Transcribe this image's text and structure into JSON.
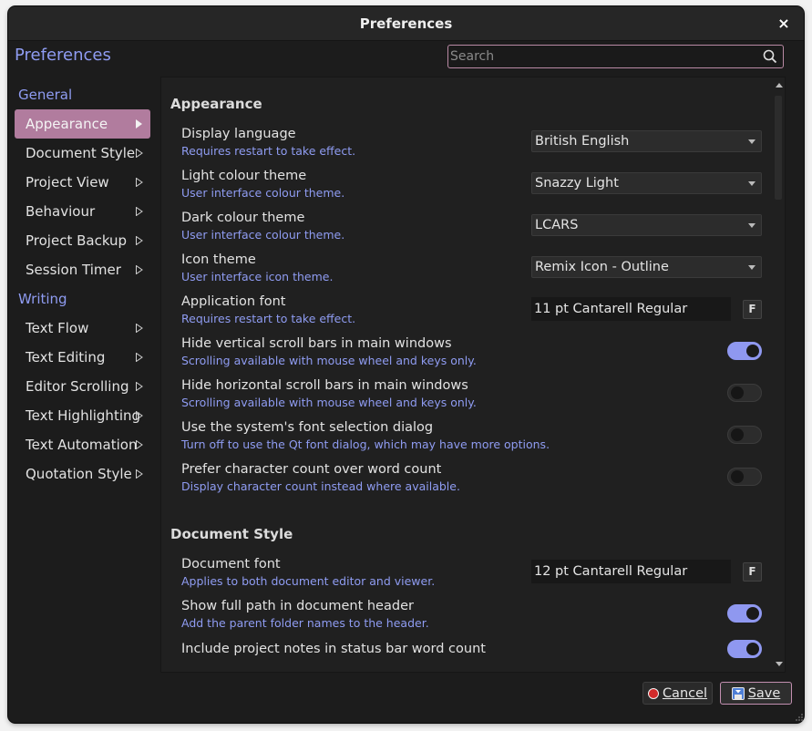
{
  "window": {
    "title": "Preferences",
    "close_glyph": "×"
  },
  "sidebar": {
    "title": "Preferences",
    "groups": [
      {
        "label": "General",
        "items": [
          "Appearance",
          "Document Style",
          "Project View",
          "Behaviour",
          "Project Backup",
          "Session Timer"
        ]
      },
      {
        "label": "Writing",
        "items": [
          "Text Flow",
          "Text Editing",
          "Editor Scrolling",
          "Text Highlighting",
          "Text Automation",
          "Quotation Style"
        ]
      }
    ],
    "selected": "Appearance"
  },
  "search": {
    "placeholder": "Search",
    "value": ""
  },
  "sections": {
    "appearance": {
      "title": "Appearance",
      "display_language": {
        "label": "Display language",
        "help": "Requires restart to take effect.",
        "value": "British English"
      },
      "light_theme": {
        "label": "Light colour theme",
        "help": "User interface colour theme.",
        "value": "Snazzy Light"
      },
      "dark_theme": {
        "label": "Dark colour theme",
        "help": "User interface colour theme.",
        "value": "LCARS"
      },
      "icon_theme": {
        "label": "Icon theme",
        "help": "User interface icon theme.",
        "value": "Remix Icon - Outline"
      },
      "app_font": {
        "label": "Application font",
        "help": "Requires restart to take effect.",
        "value": "11 pt Cantarell Regular",
        "button": "F"
      },
      "hide_vscroll": {
        "label": "Hide vertical scroll bars in main windows",
        "help": "Scrolling available with mouse wheel and keys only.",
        "on": true
      },
      "hide_hscroll": {
        "label": "Hide horizontal scroll bars in main windows",
        "help": "Scrolling available with mouse wheel and keys only.",
        "on": false
      },
      "system_font_dialog": {
        "label": "Use the system's font selection dialog",
        "help": "Turn off to use the Qt font dialog, which may have more options.",
        "on": false
      },
      "char_count": {
        "label": "Prefer character count over word count",
        "help": "Display character count instead where available.",
        "on": false
      }
    },
    "document_style": {
      "title": "Document Style",
      "doc_font": {
        "label": "Document font",
        "help": "Applies to both document editor and viewer.",
        "value": "12 pt Cantarell Regular",
        "button": "F"
      },
      "full_path": {
        "label": "Show full path in document header",
        "help": "Add the parent folder names to the header.",
        "on": true
      },
      "project_notes": {
        "label": "Include project notes in status bar word count",
        "on": true
      }
    }
  },
  "buttons": {
    "cancel": "Cancel",
    "save": "Save"
  },
  "colors": {
    "accent": "#8f9cf2",
    "selected": "#b17c9e",
    "toggle_on": "#8f98f0",
    "cancel_icon": "#d22c2c"
  }
}
